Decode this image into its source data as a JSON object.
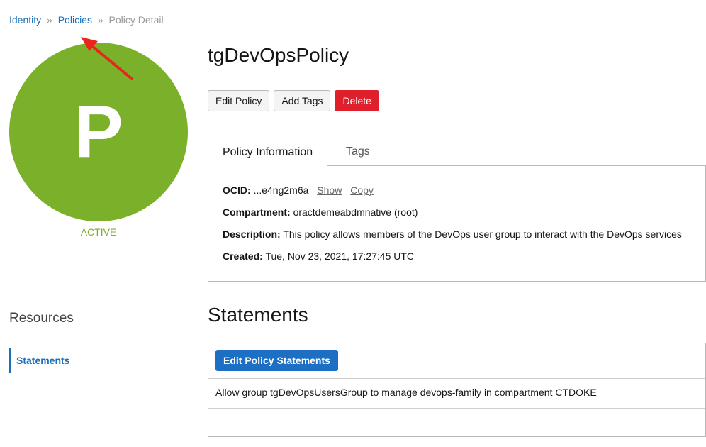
{
  "breadcrumb": {
    "items": [
      {
        "label": "Identity"
      },
      {
        "label": "Policies"
      }
    ],
    "separator": "»",
    "current": "Policy Detail"
  },
  "avatar": {
    "letter": "P",
    "color": "#7bb02a"
  },
  "status": "ACTIVE",
  "policy": {
    "name": "tgDevOpsPolicy"
  },
  "actions": {
    "edit_label": "Edit Policy",
    "add_tags_label": "Add Tags",
    "delete_label": "Delete"
  },
  "tabs": [
    {
      "label": "Policy Information",
      "active": true
    },
    {
      "label": "Tags",
      "active": false
    }
  ],
  "info": {
    "ocid_label": "OCID:",
    "ocid_value": "...e4ng2m6a",
    "show_label": "Show",
    "copy_label": "Copy",
    "compartment_label": "Compartment:",
    "compartment_value": "oractdemeabdmnative (root)",
    "description_label": "Description:",
    "description_value": "This policy allows members of the DevOps user group to interact with the DevOps services",
    "created_label": "Created:",
    "created_value": "Tue, Nov 23, 2021, 17:27:45 UTC"
  },
  "resources": {
    "heading": "Resources",
    "items": [
      {
        "label": "Statements"
      }
    ]
  },
  "statements": {
    "title": "Statements",
    "edit_button": "Edit Policy Statements",
    "rows": [
      "Allow group tgDevOpsUsersGroup to manage devops-family in compartment CTDOKE"
    ]
  },
  "colors": {
    "accent": "#1c6fb8",
    "danger": "#e01f2c",
    "active": "#7bb02a",
    "annotation": "#e8261c"
  }
}
